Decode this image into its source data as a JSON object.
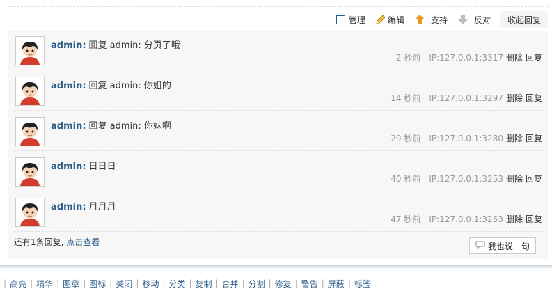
{
  "toolbar": {
    "manage_label": "管理",
    "edit_label": "编辑",
    "support_label": "支持",
    "oppose_label": "反对",
    "collapse_label": "收起回复"
  },
  "replies": [
    {
      "user": "admin:",
      "content": "回复 admin: 分页了哦",
      "time": "2 秒前",
      "ip": "IP:127.0.0.1:3317",
      "delete": "删除",
      "reply": "回复"
    },
    {
      "user": "admin:",
      "content": "回复 admin: 你姐的",
      "time": "14 秒前",
      "ip": "IP:127.0.0.1:3297",
      "delete": "删除",
      "reply": "回复"
    },
    {
      "user": "admin:",
      "content": "回复 admin: 你妹啊",
      "time": "29 秒前",
      "ip": "IP:127.0.0.1:3280",
      "delete": "删除",
      "reply": "回复"
    },
    {
      "user": "admin:",
      "content": "日日日",
      "time": "40 秒前",
      "ip": "IP:127.0.0.1:3253",
      "delete": "删除",
      "reply": "回复"
    },
    {
      "user": "admin:",
      "content": "月月月",
      "time": "47 秒前",
      "ip": "IP:127.0.0.1:3253",
      "delete": "删除",
      "reply": "回复"
    }
  ],
  "more": {
    "prefix": "还有1条回复,",
    "link": "点击查看"
  },
  "say_button": "我也说一句",
  "mod_actions": [
    "高亮",
    "精华",
    "图章",
    "图标",
    "关闭",
    "移动",
    "分类",
    "复制",
    "合并",
    "分割",
    "修复",
    "警告",
    "屏蔽",
    "标签"
  ],
  "colors": {
    "link": "#2b5d8a",
    "meta": "#999999",
    "panel_bg": "#f7f7f7"
  }
}
